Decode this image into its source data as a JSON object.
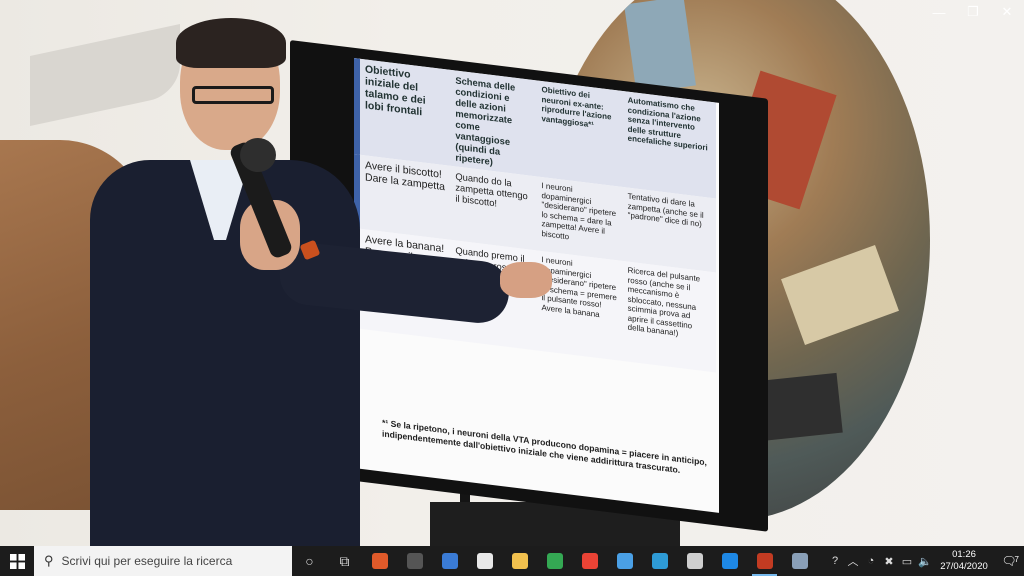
{
  "slide": {
    "headers": [
      "Obiettivo iniziale del talamo e dei lobi frontali",
      "Schema delle condizioni e delle azioni memorizzate come vantaggiose (quindi da ripetere)",
      "Obiettivo dei neuroni ex-ante: riprodurre l'azione vantaggiosa*¹",
      "Automatismo che condiziona l'azione senza l'intervento delle strutture encefaliche superiori"
    ],
    "rows": [
      [
        "Avere il biscotto! Dare la zampetta",
        "Quando do la zampetta ottengo il biscotto!",
        "I neuroni dopaminergici \"desiderano\" ripetere lo schema = dare la zampetta! Avere il biscotto",
        "Tentativo di dare la zampetta (anche se il \"padrone\" dice di no)"
      ],
      [
        "Avere la banana! Premere il pulsante",
        "Quando premo il pulsante rosso ottengo la banana!",
        "I neuroni dopaminergici \"desiderano\" ripetere lo schema = premere il pulsante rosso! Avere la banana",
        "Ricerca del pulsante rosso (anche se il meccanismo è sbloccato, nessuna scimmia prova ad aprire il cassettino della banana!)"
      ]
    ],
    "footnote_mark": "*¹",
    "footnote": "Se la ripetono, i neuroni della VTA producono dopamina = piacere in anticipo, indipendentemente dall'obiettivo iniziale che viene addirittura trascurato."
  },
  "window_controls": {
    "minimize": "—",
    "restore": "❐",
    "close": "✕"
  },
  "taskbar": {
    "search_placeholder": "Scrivi qui per eseguire la ricerca",
    "time": "01:26",
    "date": "27/04/2020",
    "notification_count": "7",
    "icons": [
      {
        "name": "cortana-icon",
        "glyph": "○",
        "color": "#dddddd"
      },
      {
        "name": "task-view-icon",
        "glyph": "⧉",
        "color": "#dddddd"
      },
      {
        "name": "app-red-icon",
        "color": "#e05a2a"
      },
      {
        "name": "app-dark-icon",
        "color": "#555555"
      },
      {
        "name": "store-icon",
        "color": "#3a7bd5"
      },
      {
        "name": "app-white-icon",
        "color": "#e8e8e8"
      },
      {
        "name": "file-explorer-icon",
        "color": "#f2c14e"
      },
      {
        "name": "chrome-icon",
        "color": "#34a853"
      },
      {
        "name": "chrome-icon-2",
        "color": "#ea4335"
      },
      {
        "name": "app-arrow-icon",
        "color": "#4aa0e6"
      },
      {
        "name": "globe-icon",
        "color": "#2e9bd6"
      },
      {
        "name": "app-doc-icon",
        "color": "#cfcfcf"
      },
      {
        "name": "edge-icon",
        "color": "#1e88e5"
      },
      {
        "name": "media-player-icon",
        "color": "#c23b22",
        "active": true
      },
      {
        "name": "app-gear-icon",
        "color": "#8aa0b8"
      }
    ],
    "colors": {
      "accent": "#76b9ed",
      "background": "#1c1c1c"
    }
  }
}
